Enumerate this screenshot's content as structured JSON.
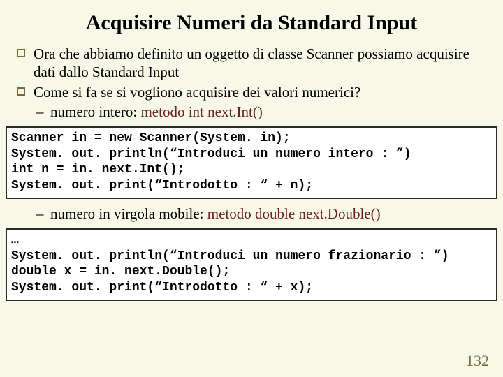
{
  "title": "Acquisire Numeri da Standard Input",
  "bullets": {
    "b1a": "Ora che abbiamo definito un oggetto di classe Scanner possiamo acquisire dati dallo Standard Input",
    "b1b": "Come si fa se si vogliono acquisire dei valori numerici?",
    "b2a_plain": "numero intero: ",
    "b2a_hl": "metodo int next.Int()",
    "b2b_plain": "numero in virgola mobile: ",
    "b2b_hl": "metodo double next.Double()"
  },
  "code1": "Scanner in = new Scanner(System. in);\nSystem. out. println(“Introduci un numero intero : ”)\nint n = in. next.Int();\nSystem. out. print(“Introdotto : “ + n);",
  "code2": "…\nSystem. out. println(“Introduci un numero frazionario : ”)\ndouble x = in. next.Double();\nSystem. out. print(“Introdotto : “ + x);",
  "page": "132"
}
